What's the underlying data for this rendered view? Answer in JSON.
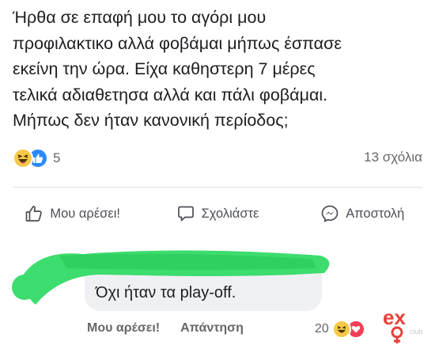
{
  "post": {
    "lines": [
      "Ήρθα σε επαφή μου το αγόρι μου",
      "προφιλακτικο αλλά φοβάμαι μήπως έσπασε",
      "εκείνη την ώρα. Είχα καθηστερη 7 μέρες",
      "τελικά αδιαθετησα αλλά και πάλι φοβάμαι.",
      "Μήπως δεν ήταν κανονική περίοδος;"
    ]
  },
  "stats": {
    "reaction_count": "5",
    "comment_count": "13 σχόλια",
    "reaction_icons": [
      "haha-icon",
      "like-icon"
    ]
  },
  "actions": {
    "like": "Μου αρέσει!",
    "comment": "Σχολιάστε",
    "send": "Αποστολή"
  },
  "comment": {
    "text": "Όχι ήταν τα play-off.",
    "like": "Μου αρέσει!",
    "reply": "Απάντηση",
    "reaction_count": "20",
    "reaction_icons": [
      "haha-icon",
      "love-icon"
    ]
  },
  "colors": {
    "scribble": "#3ddc6e",
    "like_blue": "#2d88ff",
    "haha_yellow": "#f7c948",
    "love_red": "#f33e58",
    "watermark_red": "#e8413c"
  }
}
